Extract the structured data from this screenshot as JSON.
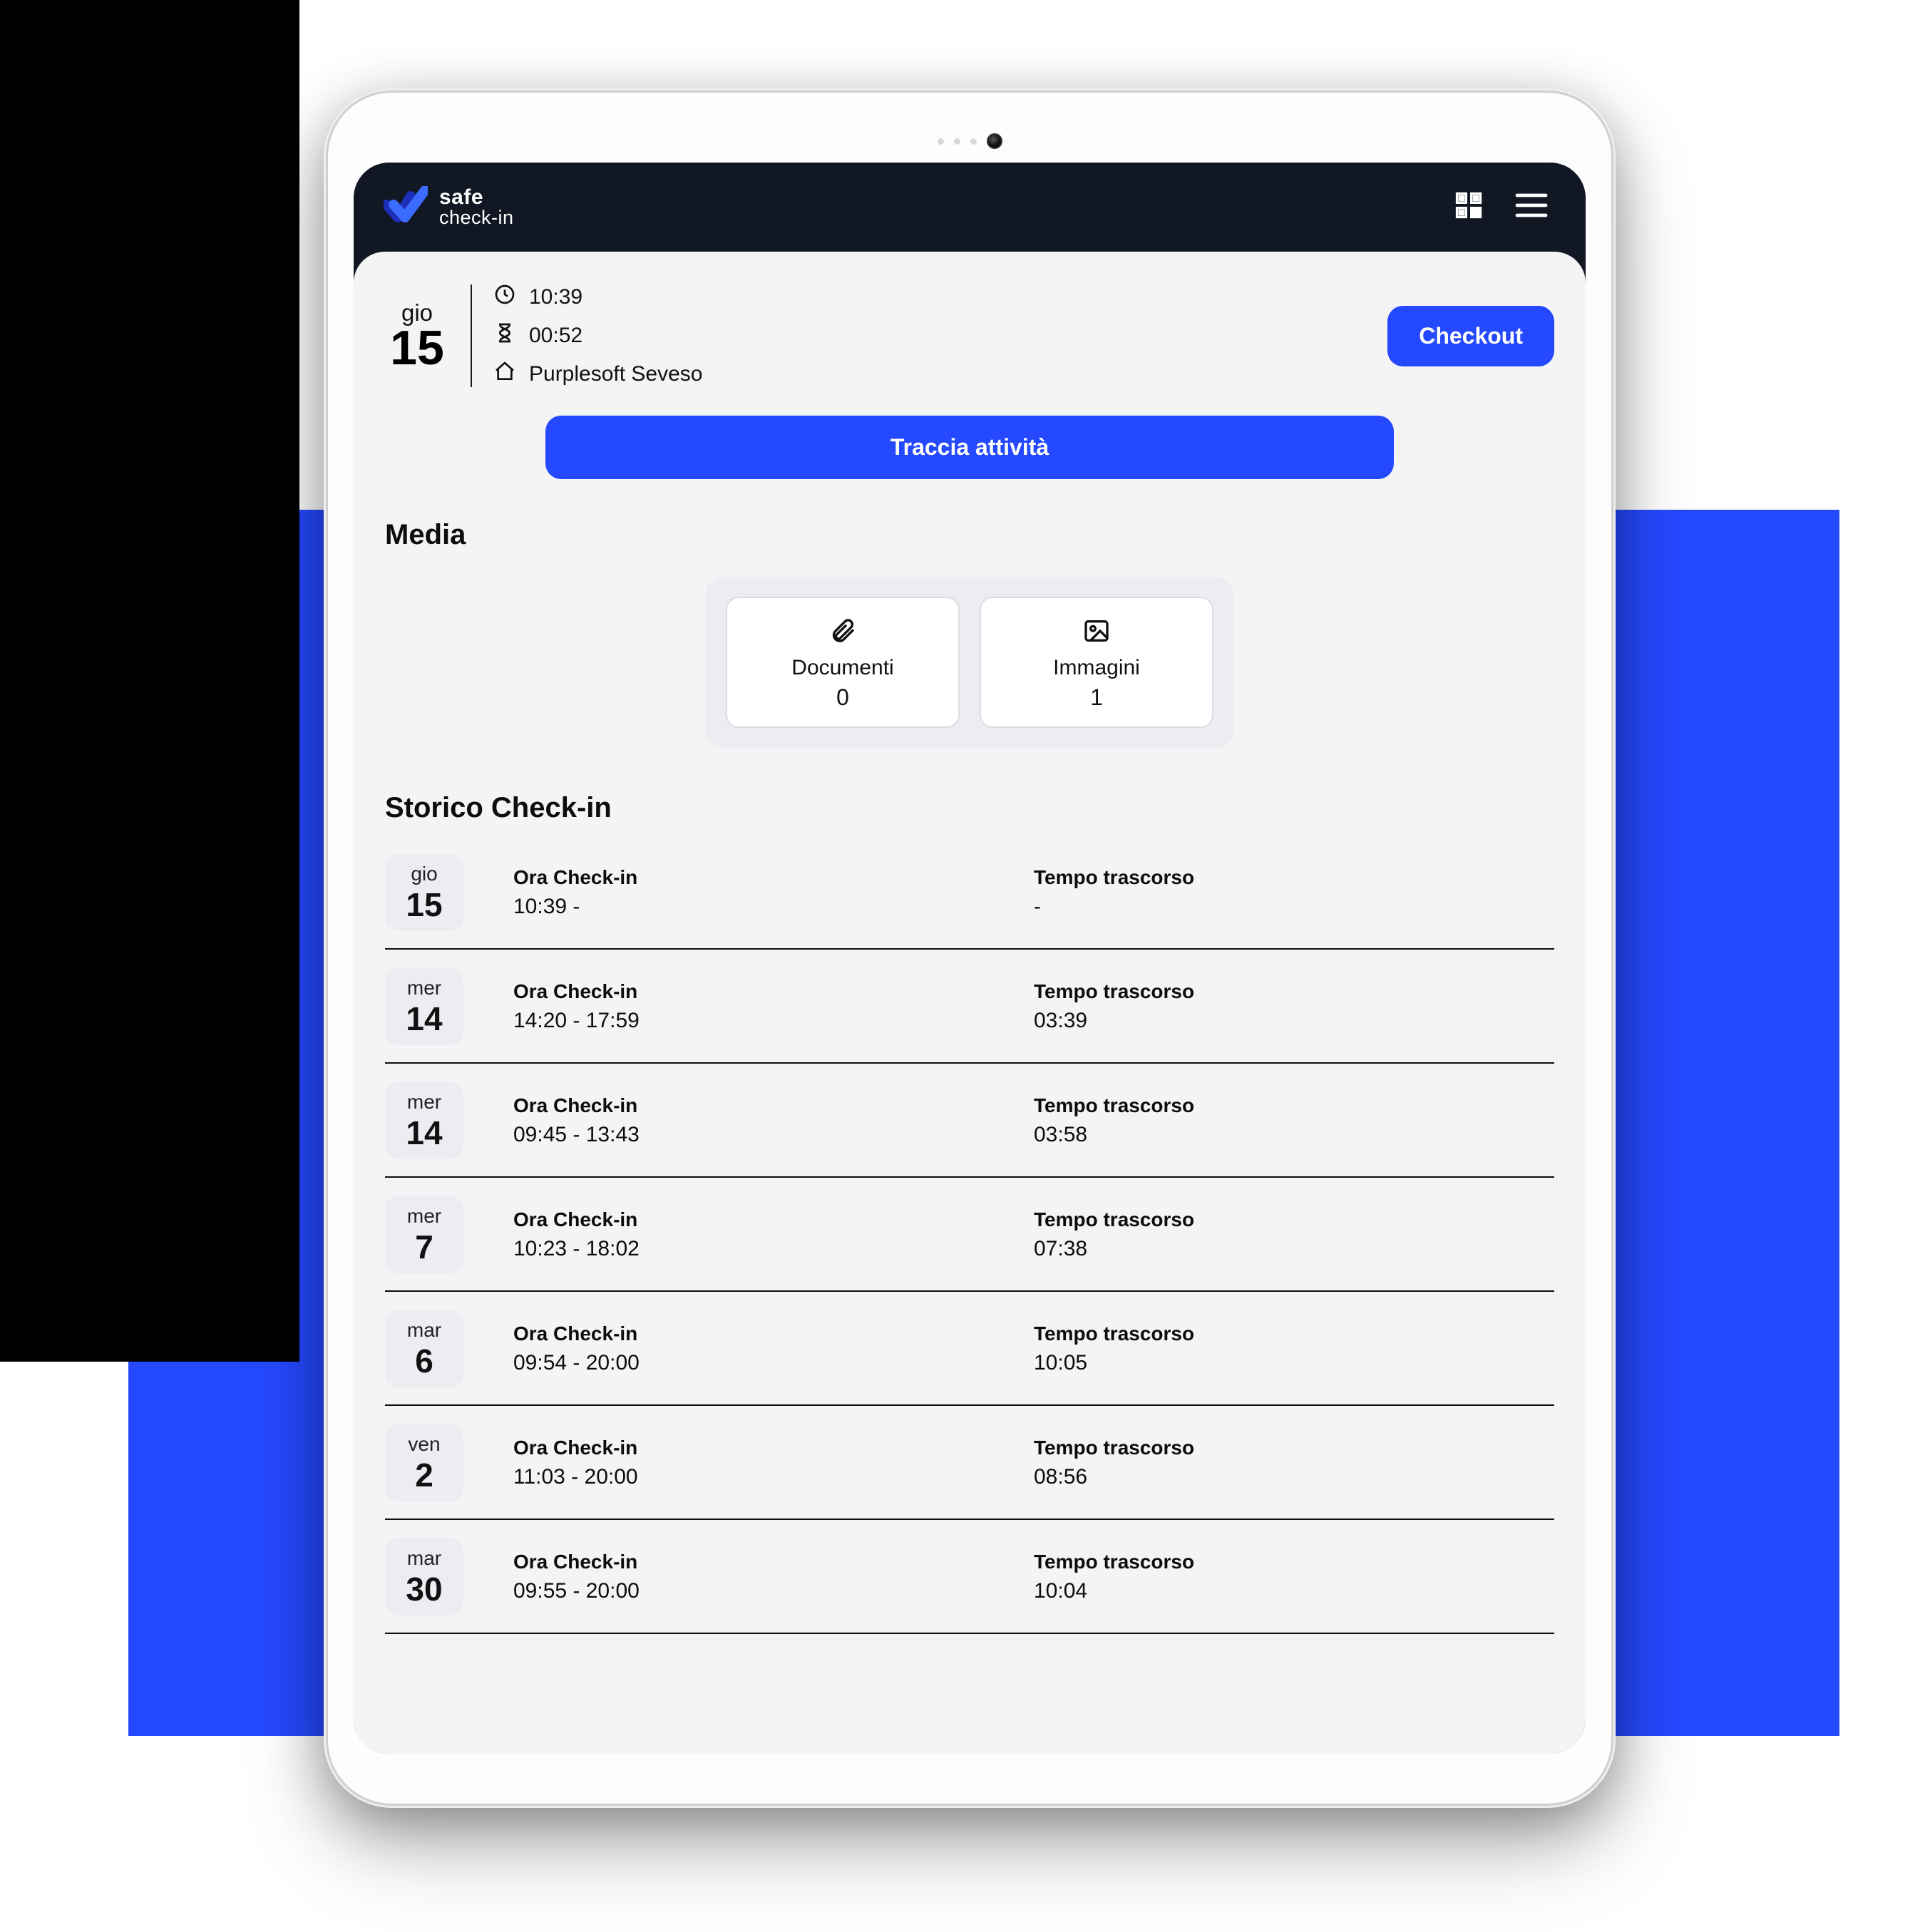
{
  "colors": {
    "accent": "#2549ff",
    "topbar": "#111824",
    "page": "#f4f4f5"
  },
  "brand": {
    "line1": "safe",
    "line2": "check-in"
  },
  "session": {
    "day_name": "gio",
    "day_number": "15",
    "time": "10:39",
    "elapsed": "00:52",
    "location": "Purplesoft Seveso"
  },
  "buttons": {
    "checkout": "Checkout",
    "track": "Traccia attività"
  },
  "sections": {
    "media": "Media",
    "history": "Storico Check-in"
  },
  "media": {
    "documents": {
      "label": "Documenti",
      "count": "0"
    },
    "images": {
      "label": "Immagini",
      "count": "1"
    }
  },
  "history_labels": {
    "checkin": "Ora Check-in",
    "elapsed": "Tempo trascorso"
  },
  "history": [
    {
      "day_name": "gio",
      "day_number": "15",
      "time_range": "10:39 -",
      "elapsed": "-"
    },
    {
      "day_name": "mer",
      "day_number": "14",
      "time_range": "14:20 - 17:59",
      "elapsed": "03:39"
    },
    {
      "day_name": "mer",
      "day_number": "14",
      "time_range": "09:45 - 13:43",
      "elapsed": "03:58"
    },
    {
      "day_name": "mer",
      "day_number": "7",
      "time_range": "10:23 - 18:02",
      "elapsed": "07:38"
    },
    {
      "day_name": "mar",
      "day_number": "6",
      "time_range": "09:54 - 20:00",
      "elapsed": "10:05"
    },
    {
      "day_name": "ven",
      "day_number": "2",
      "time_range": "11:03 - 20:00",
      "elapsed": "08:56"
    },
    {
      "day_name": "mar",
      "day_number": "30",
      "time_range": "09:55 - 20:00",
      "elapsed": "10:04"
    }
  ]
}
